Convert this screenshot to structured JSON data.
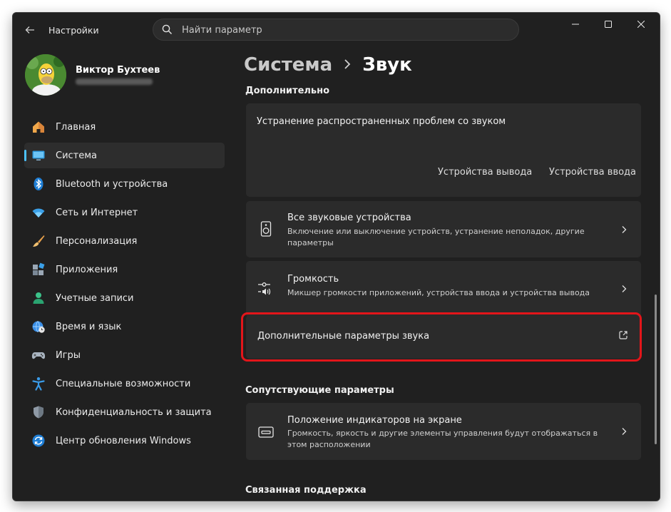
{
  "window": {
    "app_title": "Настройки"
  },
  "search": {
    "placeholder": "Найти параметр"
  },
  "user": {
    "name": "Виктор Бухтеев"
  },
  "sidebar": {
    "items": [
      {
        "label": "Главная",
        "icon": "home-icon"
      },
      {
        "label": "Система",
        "icon": "system-icon",
        "active": true
      },
      {
        "label": "Bluetooth и устройства",
        "icon": "bluetooth-icon"
      },
      {
        "label": "Сеть и Интернет",
        "icon": "wifi-icon"
      },
      {
        "label": "Персонализация",
        "icon": "brush-icon"
      },
      {
        "label": "Приложения",
        "icon": "apps-icon"
      },
      {
        "label": "Учетные записи",
        "icon": "person-icon"
      },
      {
        "label": "Время и язык",
        "icon": "globe-clock-icon"
      },
      {
        "label": "Игры",
        "icon": "gamepad-icon"
      },
      {
        "label": "Специальные возможности",
        "icon": "accessibility-icon"
      },
      {
        "label": "Конфиденциальность и защита",
        "icon": "shield-icon"
      },
      {
        "label": "Центр обновления Windows",
        "icon": "update-icon"
      }
    ]
  },
  "breadcrumb": {
    "parent": "Система",
    "current": "Звук"
  },
  "sections": {
    "advanced": "Дополнительно",
    "related_settings": "Сопутствующие параметры",
    "related_support": "Связанная поддержка"
  },
  "troubleshoot": {
    "title": "Устранение распространенных проблем со звуком",
    "output_btn": "Устройства вывода",
    "input_btn": "Устройства ввода"
  },
  "all_devices": {
    "title": "Все звуковые устройства",
    "desc": "Включение или выключение устройств, устранение неполадок, другие параметры"
  },
  "volume": {
    "title": "Громкость",
    "desc": "Микшер громкости приложений, устройства ввода и устройства вывода"
  },
  "more_sound": {
    "title": "Дополнительные параметры звука"
  },
  "indicator": {
    "title": "Положение индикаторов на экране",
    "desc": "Громкость, яркость и другие элементы управления будут отображаться в этом расположении"
  },
  "colors": {
    "accent": "#4cc2ff",
    "highlight": "#e3151a",
    "card": "#2b2b2b",
    "background": "#202020"
  }
}
